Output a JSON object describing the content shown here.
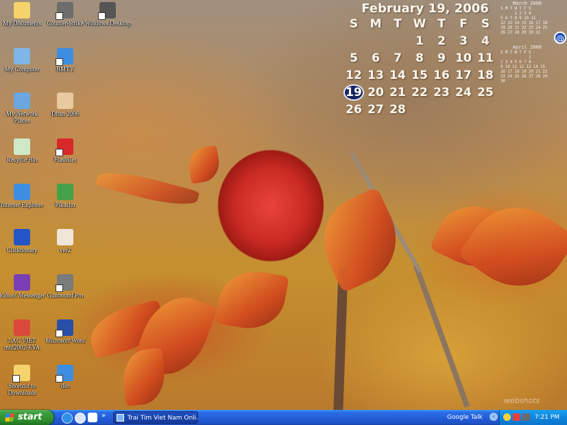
{
  "desktop": {
    "icons": [
      {
        "label": "My Documents",
        "icon": "folder-icon",
        "color": "#f4d36a"
      },
      {
        "label": "My Computer",
        "icon": "computer-icon",
        "color": "#7fb6e8"
      },
      {
        "label": "My Network Places",
        "icon": "network-icon",
        "color": "#6aa7e0"
      },
      {
        "label": "Recycle Bin",
        "icon": "recycle-bin-icon",
        "color": "#cfe8c8"
      },
      {
        "label": "Internet Explorer",
        "icon": "ie-icon",
        "color": "#3d8ee0"
      },
      {
        "label": "Clicktionary",
        "icon": "dictionary-icon",
        "color": "#2456c7"
      },
      {
        "label": "Yahoo! Messenger",
        "icon": "yahoo-messenger-icon",
        "color": "#7b3fb5"
      },
      {
        "label": "LAC VIET mtd2002-EVA",
        "icon": "lacviet-icon",
        "color": "#d9483b"
      },
      {
        "label": "Shortcut to Downloads",
        "icon": "folder-shortcut-icon",
        "color": "#f4d36a"
      },
      {
        "label": "Counter-Strike",
        "icon": "game-icon",
        "color": "#6d6d6d"
      },
      {
        "label": "BMTY",
        "icon": "ie-shortcut-icon",
        "color": "#3d8ee0"
      },
      {
        "label": "Dhan 2006",
        "icon": "character-icon",
        "color": "#e8c9a0"
      },
      {
        "label": "FlashGet",
        "icon": "flashget-icon",
        "color": "#d8282a"
      },
      {
        "label": "Pikachu",
        "icon": "pikachu-icon",
        "color": "#43a047"
      },
      {
        "label": "ver2",
        "icon": "app-icon",
        "color": "#efe6d8"
      },
      {
        "label": "Gunbound Pro",
        "icon": "gunbound-icon",
        "color": "#7a7a7a"
      },
      {
        "label": "Microsoft Word",
        "icon": "word-icon",
        "color": "#2a4fa8"
      },
      {
        "label": "dsb",
        "icon": "ie-shortcut-icon",
        "color": "#3d8ee0"
      },
      {
        "label": "Windows Desktop",
        "icon": "camera-icon",
        "color": "#555555"
      }
    ]
  },
  "calendar": {
    "title": "February 19, 2006",
    "weekdays": [
      "S",
      "M",
      "T",
      "W",
      "T",
      "F",
      "S"
    ],
    "cells": [
      "",
      "",
      "",
      "1",
      "2",
      "3",
      "4",
      "5",
      "6",
      "7",
      "8",
      "9",
      "10",
      "11",
      "12",
      "13",
      "14",
      "15",
      "16",
      "17",
      "18",
      "19",
      "20",
      "21",
      "22",
      "23",
      "24",
      "25",
      "26",
      "27",
      "28"
    ],
    "today": "19"
  },
  "mini_calendars": [
    {
      "title": "March 2006",
      "rows": [
        "S M T W T F S",
        "      1 2 3 4",
        "5 6 7 8 9 10 11",
        "12 13 14 15 16 17 18",
        "19 20 21 22 23 24 25",
        "26 27 28 29 30 31"
      ]
    },
    {
      "title": "April 2006",
      "rows": [
        "S M T W T F S",
        "            1",
        "2 3 4 5 6 7 8",
        "9 10 11 12 13 14 15",
        "16 17 18 19 20 21 22",
        "23 24 25 26 27 28 29",
        "30"
      ]
    }
  ],
  "taskbar": {
    "start_label": "start",
    "task_button_label": "Trai Tim Viet Nam Onli...",
    "google_talk": "Google Talk",
    "clock": "7:21 PM",
    "colors": {
      "bar": "#245edb",
      "start": "#3c9e3c",
      "tray": "#0f86df"
    }
  },
  "watermark": "webshots"
}
